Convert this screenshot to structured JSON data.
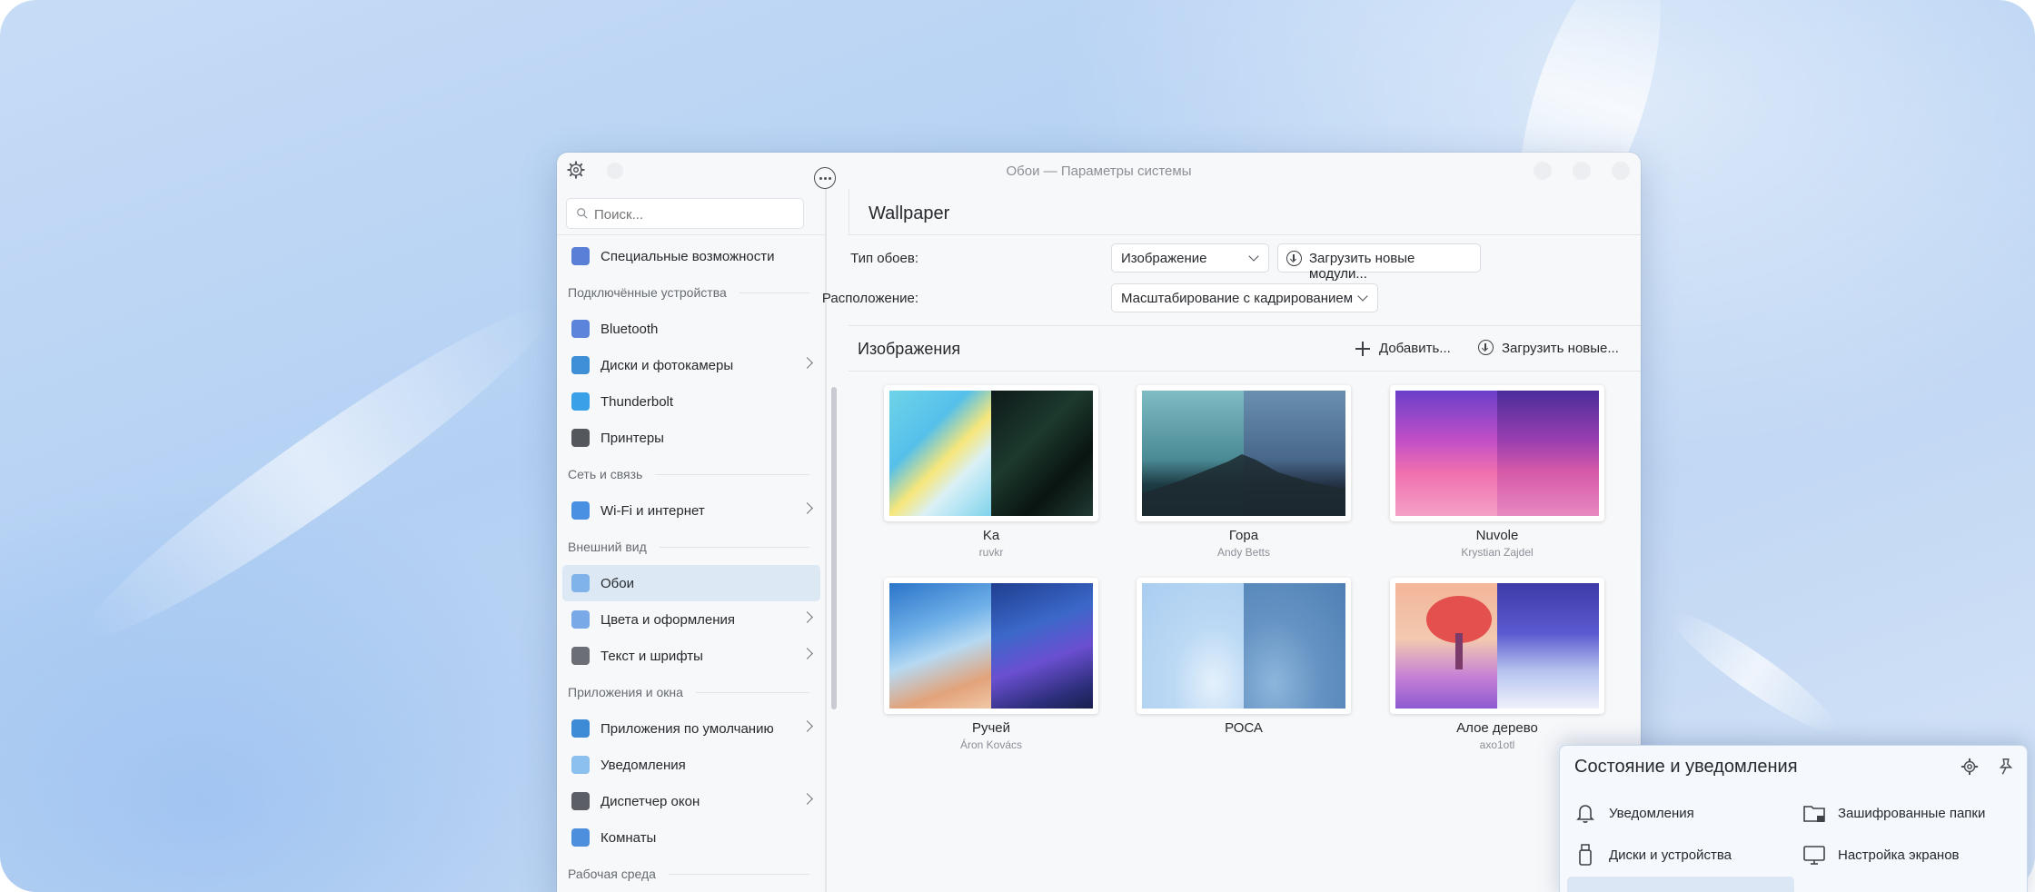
{
  "window": {
    "title": "Обои — Параметры системы"
  },
  "search": {
    "placeholder": "Поиск..."
  },
  "sidebar": {
    "items": [
      {
        "type": "item",
        "label": "Специальные возможности",
        "icon": "accessibility-icon",
        "color": "#5a7fd6",
        "chevron": false
      },
      {
        "type": "header",
        "label": "Подключённые устройства"
      },
      {
        "type": "item",
        "label": "Bluetooth",
        "icon": "bluetooth-icon",
        "color": "#5d84db",
        "chevron": false
      },
      {
        "type": "item",
        "label": "Диски и фотокамеры",
        "icon": "disks-icon",
        "color": "#3f8fd6",
        "chevron": true
      },
      {
        "type": "item",
        "label": "Thunderbolt",
        "icon": "thunderbolt-icon",
        "color": "#3aa0e8",
        "chevron": false
      },
      {
        "type": "item",
        "label": "Принтеры",
        "icon": "printer-icon",
        "color": "#54575c",
        "chevron": false
      },
      {
        "type": "header",
        "label": "Сеть и связь"
      },
      {
        "type": "item",
        "label": "Wi-Fi и интернет",
        "icon": "wifi-icon",
        "color": "#4a90e2",
        "chevron": true
      },
      {
        "type": "header",
        "label": "Внешний вид"
      },
      {
        "type": "item",
        "label": "Обои",
        "icon": "wallpaper-icon",
        "color": "#7fb3ea",
        "chevron": false,
        "active": true
      },
      {
        "type": "item",
        "label": "Цвета и оформления",
        "icon": "colors-icon",
        "color": "#79a9e6",
        "chevron": true
      },
      {
        "type": "item",
        "label": "Текст и шрифты",
        "icon": "fonts-icon",
        "color": "#6b6f75",
        "chevron": true
      },
      {
        "type": "header",
        "label": "Приложения и окна"
      },
      {
        "type": "item",
        "label": "Приложения по умолчанию",
        "icon": "default-apps-icon",
        "color": "#3d8ad6",
        "chevron": true
      },
      {
        "type": "item",
        "label": "Уведомления",
        "icon": "notifications-icon",
        "color": "#8cc0ee",
        "chevron": false
      },
      {
        "type": "item",
        "label": "Диспетчер окон",
        "icon": "window-manager-icon",
        "color": "#5b5f65",
        "chevron": true
      },
      {
        "type": "item",
        "label": "Комнаты",
        "icon": "activities-icon",
        "color": "#4d8fdc",
        "chevron": false
      },
      {
        "type": "header",
        "label": "Рабочая среда"
      }
    ]
  },
  "main": {
    "page_title": "Wallpaper",
    "wallpaper_type_label": "Тип обоев:",
    "wallpaper_type_value": "Изображение",
    "get_plugins_label": "Загрузить новые модули...",
    "positioning_label": "Расположение:",
    "positioning_value": "Масштабирование с кадрированием",
    "images_title": "Изображения",
    "add_label": "Добавить...",
    "get_new_label": "Загрузить новые...",
    "wallpapers": [
      {
        "name": "Ka",
        "author": "ruvkr"
      },
      {
        "name": "Гора",
        "author": "Andy Betts"
      },
      {
        "name": "Nuvole",
        "author": "Krystian Zajdel"
      },
      {
        "name": "Ручей",
        "author": "Áron Kovács"
      },
      {
        "name": "РОСА",
        "author": ""
      },
      {
        "name": "Алое дерево",
        "author": "axo1otl"
      }
    ]
  },
  "popup": {
    "title": "Состояние и уведомления",
    "items": [
      {
        "label": "Уведомления",
        "icon": "bell-icon"
      },
      {
        "label": "Зашифрованные папки",
        "icon": "encrypted-folder-icon"
      },
      {
        "label": "Диски и устройства",
        "icon": "usb-drive-icon"
      },
      {
        "label": "Настройка экранов",
        "icon": "display-icon"
      }
    ]
  },
  "colors": {
    "accent": "#3daee9",
    "active_item_bg": "#dde8f5",
    "window_bg": "#f7f8fa"
  }
}
